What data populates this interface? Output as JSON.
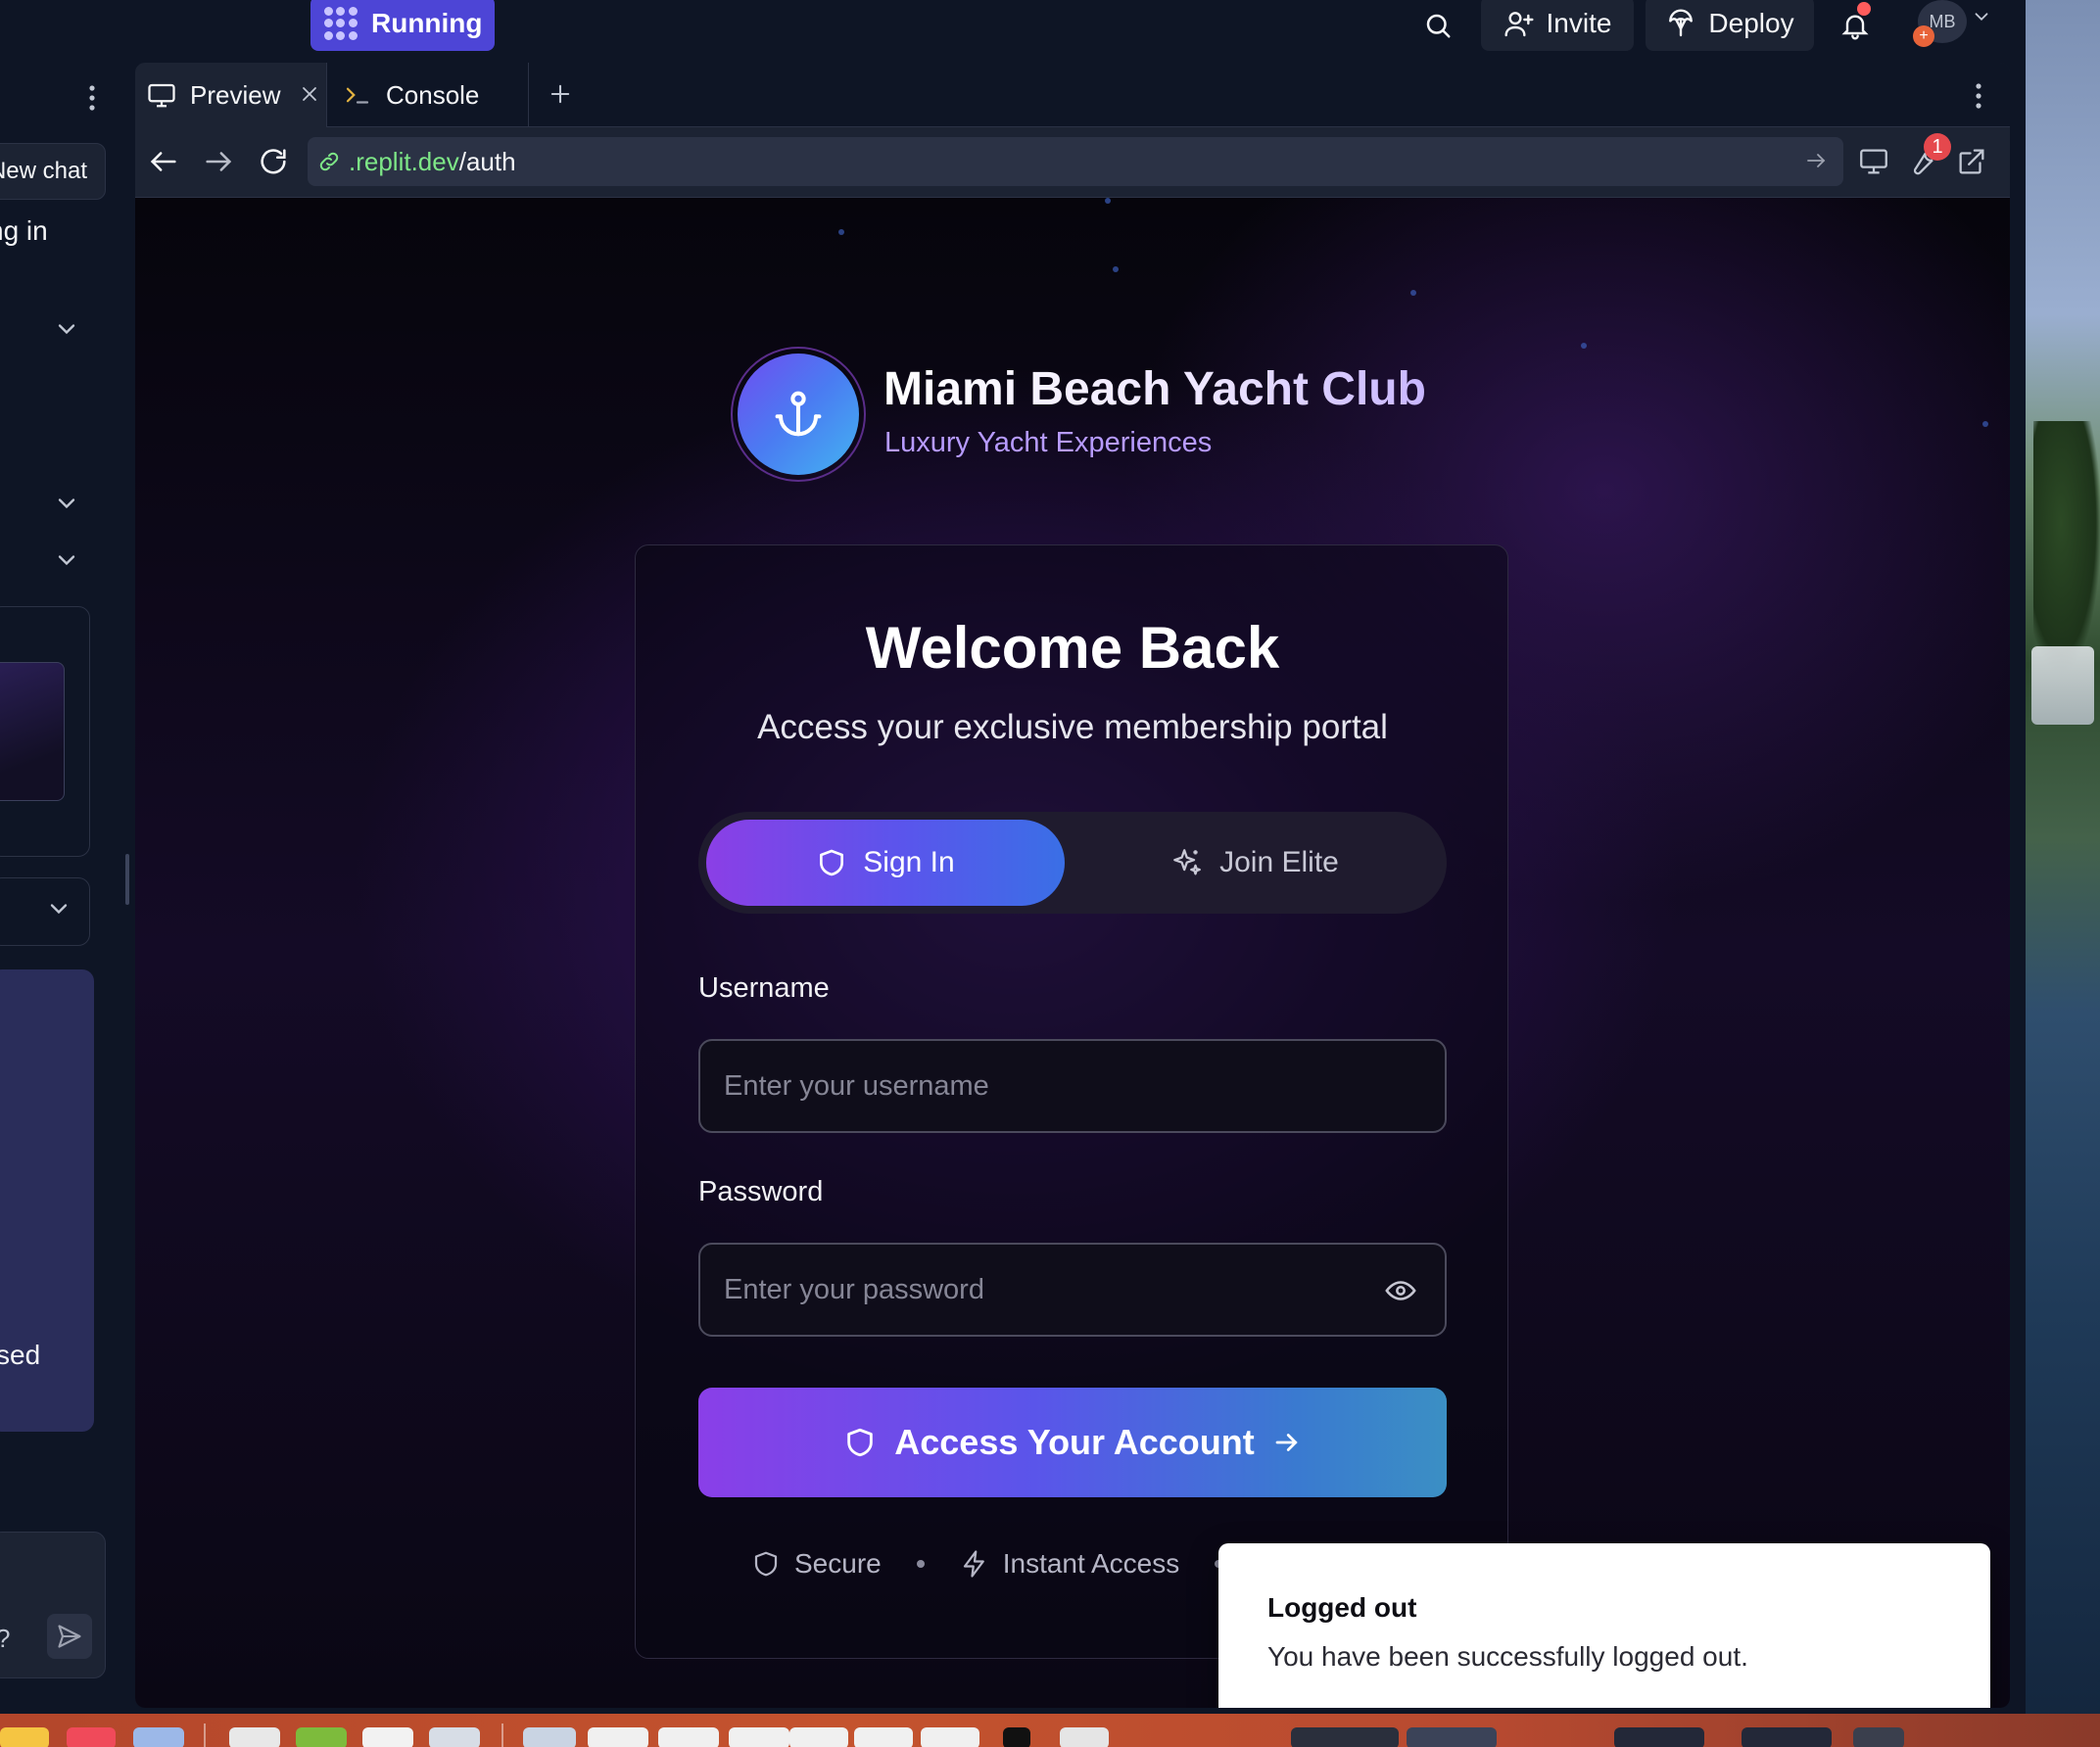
{
  "topbar": {
    "run_label": "Running",
    "invite_label": "Invite",
    "deploy_label": "Deploy",
    "avatar_initials": "MB"
  },
  "sidebar": {
    "new_chat_label": "New chat",
    "heading_fragment": "ng in",
    "panel_text_fragment": "sed",
    "input_text_fragment": "?"
  },
  "pane": {
    "tabs": [
      {
        "label": "Preview",
        "icon": "monitor-icon"
      },
      {
        "label": "Console",
        "icon": "terminal-icon"
      }
    ],
    "url_host": ".replit.dev",
    "url_path": "/auth",
    "devtools_badge": "1"
  },
  "app": {
    "brand_title": "Miami Beach Yacht Club",
    "brand_subtitle": "Luxury Yacht Experiences",
    "welcome_title": "Welcome Back",
    "welcome_subtitle": "Access your exclusive membership portal",
    "toggle": {
      "sign_in": "Sign In",
      "join": "Join Elite",
      "selected": "Sign In"
    },
    "username": {
      "label": "Username",
      "placeholder": "Enter your username",
      "value": ""
    },
    "password": {
      "label": "Password",
      "placeholder": "Enter your password",
      "value": ""
    },
    "submit_label": "Access Your Account",
    "features": [
      "Secure",
      "Instant Access"
    ]
  },
  "toast": {
    "title": "Logged out",
    "description": "You have been successfully logged out."
  },
  "colors": {
    "accent_purple": "#8b3fe6",
    "accent_blue": "#3a6fe6",
    "run_button": "#4d45d6",
    "url_host": "#7ee787",
    "brand_subtitle": "#b79bff"
  }
}
